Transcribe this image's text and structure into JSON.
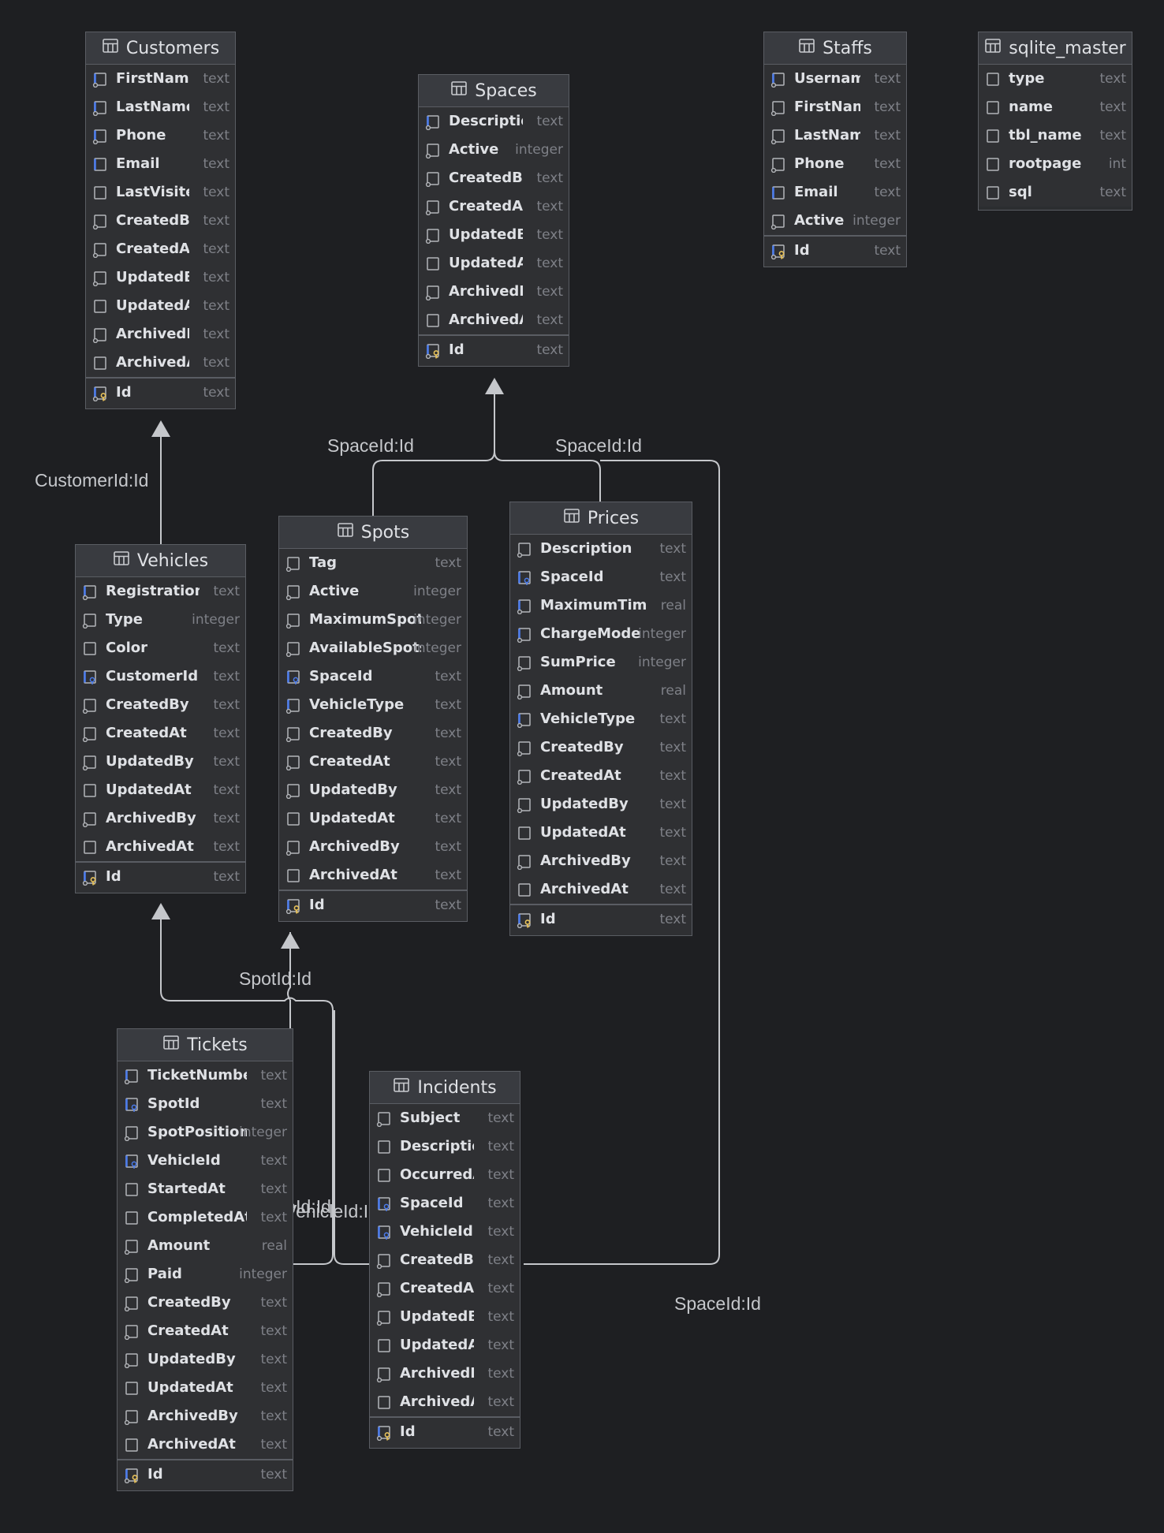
{
  "colors": {
    "background": "#1e1f22",
    "table_body": "#2f3033",
    "table_header": "#393b40",
    "border": "#5a5d63",
    "text": "#dfe1e5",
    "type_text": "#7e8087",
    "connector": "#c5c7cb",
    "fk_icon_accent": "#4b7bec",
    "pk_icon_accent": "#e8c25a"
  },
  "tables": [
    {
      "key": "customers",
      "name": "Customers",
      "columns": [
        {
          "name": "FirstName",
          "type": "text",
          "icon": "fk-column-icon"
        },
        {
          "name": "LastName",
          "type": "text",
          "icon": "fk-column-icon"
        },
        {
          "name": "Phone",
          "type": "text",
          "icon": "fk-column-icon"
        },
        {
          "name": "Email",
          "type": "text",
          "icon": "index-column-icon"
        },
        {
          "name": "LastVisited",
          "type": "text",
          "icon": "column-icon"
        },
        {
          "name": "CreatedBy",
          "type": "text",
          "icon": "notnull-column-icon"
        },
        {
          "name": "CreatedAt",
          "type": "text",
          "icon": "notnull-column-icon"
        },
        {
          "name": "UpdatedBy",
          "type": "text",
          "icon": "notnull-column-icon"
        },
        {
          "name": "UpdatedAt",
          "type": "text",
          "icon": "column-icon"
        },
        {
          "name": "ArchivedBy",
          "type": "text",
          "icon": "notnull-column-icon"
        },
        {
          "name": "ArchivedAt",
          "type": "text",
          "icon": "column-icon"
        }
      ],
      "pk": {
        "name": "Id",
        "type": "text"
      }
    },
    {
      "key": "spaces",
      "name": "Spaces",
      "columns": [
        {
          "name": "Description",
          "type": "text",
          "icon": "fk-column-icon"
        },
        {
          "name": "Active",
          "type": "integer",
          "icon": "notnull-column-icon"
        },
        {
          "name": "CreatedBy",
          "type": "text",
          "icon": "notnull-column-icon"
        },
        {
          "name": "CreatedAt",
          "type": "text",
          "icon": "notnull-column-icon"
        },
        {
          "name": "UpdatedBy",
          "type": "text",
          "icon": "notnull-column-icon"
        },
        {
          "name": "UpdatedAt",
          "type": "text",
          "icon": "column-icon"
        },
        {
          "name": "ArchivedBy",
          "type": "text",
          "icon": "notnull-column-icon"
        },
        {
          "name": "ArchivedAt",
          "type": "text",
          "icon": "column-icon"
        }
      ],
      "pk": {
        "name": "Id",
        "type": "text"
      }
    },
    {
      "key": "staffs",
      "name": "Staffs",
      "columns": [
        {
          "name": "Username",
          "type": "text",
          "icon": "fk-column-icon"
        },
        {
          "name": "FirstName",
          "type": "text",
          "icon": "notnull-column-icon"
        },
        {
          "name": "LastName",
          "type": "text",
          "icon": "notnull-column-icon"
        },
        {
          "name": "Phone",
          "type": "text",
          "icon": "notnull-column-icon"
        },
        {
          "name": "Email",
          "type": "text",
          "icon": "index-column-icon"
        },
        {
          "name": "Active",
          "type": "integer",
          "icon": "notnull-column-icon"
        }
      ],
      "pk": {
        "name": "Id",
        "type": "text"
      }
    },
    {
      "key": "sqlite_master",
      "name": "sqlite_master",
      "columns": [
        {
          "name": "type",
          "type": "text",
          "icon": "column-icon"
        },
        {
          "name": "name",
          "type": "text",
          "icon": "column-icon"
        },
        {
          "name": "tbl_name",
          "type": "text",
          "icon": "column-icon"
        },
        {
          "name": "rootpage",
          "type": "int",
          "icon": "column-icon"
        },
        {
          "name": "sql",
          "type": "text",
          "icon": "column-icon"
        }
      ],
      "pk": null
    },
    {
      "key": "vehicles",
      "name": "Vehicles",
      "columns": [
        {
          "name": "RegistrationNumber",
          "type": "text",
          "icon": "fk-column-icon"
        },
        {
          "name": "Type",
          "type": "integer",
          "icon": "notnull-column-icon"
        },
        {
          "name": "Color",
          "type": "text",
          "icon": "column-icon"
        },
        {
          "name": "CustomerId",
          "type": "text",
          "icon": "fk-ref-column-icon"
        },
        {
          "name": "CreatedBy",
          "type": "text",
          "icon": "notnull-column-icon"
        },
        {
          "name": "CreatedAt",
          "type": "text",
          "icon": "notnull-column-icon"
        },
        {
          "name": "UpdatedBy",
          "type": "text",
          "icon": "notnull-column-icon"
        },
        {
          "name": "UpdatedAt",
          "type": "text",
          "icon": "column-icon"
        },
        {
          "name": "ArchivedBy",
          "type": "text",
          "icon": "notnull-column-icon"
        },
        {
          "name": "ArchivedAt",
          "type": "text",
          "icon": "column-icon"
        }
      ],
      "pk": {
        "name": "Id",
        "type": "text"
      }
    },
    {
      "key": "spots",
      "name": "Spots",
      "columns": [
        {
          "name": "Tag",
          "type": "text",
          "icon": "notnull-column-icon"
        },
        {
          "name": "Active",
          "type": "integer",
          "icon": "notnull-column-icon"
        },
        {
          "name": "MaximumSpots",
          "type": "integer",
          "icon": "notnull-column-icon"
        },
        {
          "name": "AvailableSpots",
          "type": "integer",
          "icon": "notnull-column-icon"
        },
        {
          "name": "SpaceId",
          "type": "text",
          "icon": "fk-ref-column-icon"
        },
        {
          "name": "VehicleType",
          "type": "text",
          "icon": "fk-column-icon"
        },
        {
          "name": "CreatedBy",
          "type": "text",
          "icon": "notnull-column-icon"
        },
        {
          "name": "CreatedAt",
          "type": "text",
          "icon": "notnull-column-icon"
        },
        {
          "name": "UpdatedBy",
          "type": "text",
          "icon": "notnull-column-icon"
        },
        {
          "name": "UpdatedAt",
          "type": "text",
          "icon": "column-icon"
        },
        {
          "name": "ArchivedBy",
          "type": "text",
          "icon": "notnull-column-icon"
        },
        {
          "name": "ArchivedAt",
          "type": "text",
          "icon": "column-icon"
        }
      ],
      "pk": {
        "name": "Id",
        "type": "text"
      }
    },
    {
      "key": "prices",
      "name": "Prices",
      "columns": [
        {
          "name": "Description",
          "type": "text",
          "icon": "notnull-column-icon"
        },
        {
          "name": "SpaceId",
          "type": "text",
          "icon": "fk-ref-column-icon"
        },
        {
          "name": "MaximumTime",
          "type": "real",
          "icon": "fk-column-icon"
        },
        {
          "name": "ChargeMode",
          "type": "integer",
          "icon": "fk-column-icon"
        },
        {
          "name": "SumPrice",
          "type": "integer",
          "icon": "notnull-column-icon"
        },
        {
          "name": "Amount",
          "type": "real",
          "icon": "notnull-column-icon"
        },
        {
          "name": "VehicleType",
          "type": "text",
          "icon": "fk-column-icon"
        },
        {
          "name": "CreatedBy",
          "type": "text",
          "icon": "notnull-column-icon"
        },
        {
          "name": "CreatedAt",
          "type": "text",
          "icon": "notnull-column-icon"
        },
        {
          "name": "UpdatedBy",
          "type": "text",
          "icon": "notnull-column-icon"
        },
        {
          "name": "UpdatedAt",
          "type": "text",
          "icon": "column-icon"
        },
        {
          "name": "ArchivedBy",
          "type": "text",
          "icon": "notnull-column-icon"
        },
        {
          "name": "ArchivedAt",
          "type": "text",
          "icon": "column-icon"
        }
      ],
      "pk": {
        "name": "Id",
        "type": "text"
      }
    },
    {
      "key": "tickets",
      "name": "Tickets",
      "columns": [
        {
          "name": "TicketNumber",
          "type": "text",
          "icon": "fk-column-icon"
        },
        {
          "name": "SpotId",
          "type": "text",
          "icon": "fk-ref-column-icon"
        },
        {
          "name": "SpotPosition",
          "type": "integer",
          "icon": "notnull-column-icon"
        },
        {
          "name": "VehicleId",
          "type": "text",
          "icon": "fk-ref-column-icon"
        },
        {
          "name": "StartedAt",
          "type": "text",
          "icon": "column-icon"
        },
        {
          "name": "CompletedAt",
          "type": "text",
          "icon": "column-icon"
        },
        {
          "name": "Amount",
          "type": "real",
          "icon": "notnull-column-icon"
        },
        {
          "name": "Paid",
          "type": "integer",
          "icon": "notnull-column-icon"
        },
        {
          "name": "CreatedBy",
          "type": "text",
          "icon": "notnull-column-icon"
        },
        {
          "name": "CreatedAt",
          "type": "text",
          "icon": "notnull-column-icon"
        },
        {
          "name": "UpdatedBy",
          "type": "text",
          "icon": "notnull-column-icon"
        },
        {
          "name": "UpdatedAt",
          "type": "text",
          "icon": "column-icon"
        },
        {
          "name": "ArchivedBy",
          "type": "text",
          "icon": "notnull-column-icon"
        },
        {
          "name": "ArchivedAt",
          "type": "text",
          "icon": "column-icon"
        }
      ],
      "pk": {
        "name": "Id",
        "type": "text"
      }
    },
    {
      "key": "incidents",
      "name": "Incidents",
      "columns": [
        {
          "name": "Subject",
          "type": "text",
          "icon": "notnull-column-icon"
        },
        {
          "name": "Description",
          "type": "text",
          "icon": "column-icon"
        },
        {
          "name": "OccurredAt",
          "type": "text",
          "icon": "column-icon"
        },
        {
          "name": "SpaceId",
          "type": "text",
          "icon": "fk-ref-column-icon"
        },
        {
          "name": "VehicleId",
          "type": "text",
          "icon": "fk-ref-column-icon"
        },
        {
          "name": "CreatedBy",
          "type": "text",
          "icon": "notnull-column-icon"
        },
        {
          "name": "CreatedAt",
          "type": "text",
          "icon": "notnull-column-icon"
        },
        {
          "name": "UpdatedBy",
          "type": "text",
          "icon": "notnull-column-icon"
        },
        {
          "name": "UpdatedAt",
          "type": "text",
          "icon": "column-icon"
        },
        {
          "name": "ArchivedBy",
          "type": "text",
          "icon": "notnull-column-icon"
        },
        {
          "name": "ArchivedAt",
          "type": "text",
          "icon": "column-icon"
        }
      ],
      "pk": {
        "name": "Id",
        "type": "text"
      }
    }
  ],
  "relations": [
    {
      "key": "vehicles-customers",
      "label": "CustomerId:Id"
    },
    {
      "key": "spots-spaces",
      "label": "SpaceId:Id"
    },
    {
      "key": "prices-spaces",
      "label": "SpaceId:Id"
    },
    {
      "key": "tickets-spots",
      "label": "SpotId:Id"
    },
    {
      "key": "tickets-vehicles",
      "label": "VehicleId:Id"
    },
    {
      "key": "incidents-vehicles",
      "label": "VehicleId:Id"
    },
    {
      "key": "incidents-spaces",
      "label": "SpaceId:Id"
    }
  ]
}
